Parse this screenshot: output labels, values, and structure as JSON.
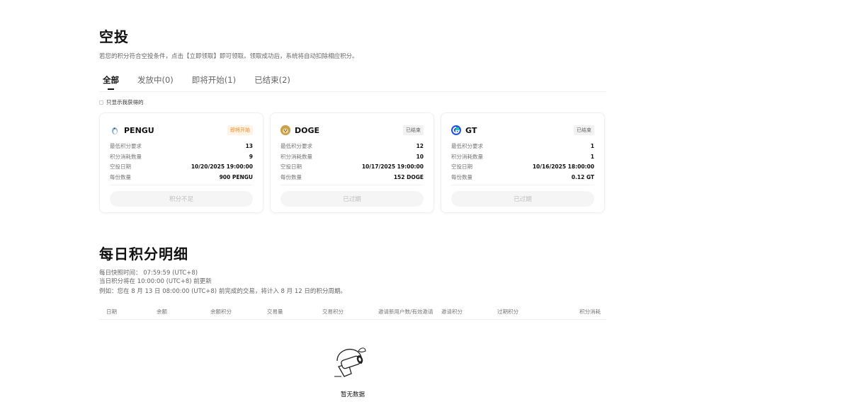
{
  "airdrop": {
    "title": "空投",
    "description": "若您的积分符合空投条件，点击【立即领取】即可领取。领取成功后，系统将自动扣除相应积分。",
    "tabs": [
      "全部",
      "发放中(0)",
      "即将开始(1)",
      "已结束(2)"
    ],
    "active_tab": "全部",
    "only_mine_label": "只显示我获得的",
    "cards": [
      {
        "coin": "PENGU",
        "icon": "penguin-icon",
        "status": "即将开始",
        "status_color": "#f08a24",
        "rows": [
          {
            "label": "最低积分要求",
            "value": "13"
          },
          {
            "label": "积分消耗数量",
            "value": "9"
          },
          {
            "label": "空投日期",
            "value": "10/20/2025 19:00:00"
          },
          {
            "label": "每份数量",
            "value": "900 PENGU"
          }
        ],
        "button": "积分不足"
      },
      {
        "coin": "DOGE",
        "icon": "doge-icon",
        "status": "已结束",
        "status_color": "#666666",
        "rows": [
          {
            "label": "最低积分要求",
            "value": "12"
          },
          {
            "label": "积分消耗数量",
            "value": "10"
          },
          {
            "label": "空投日期",
            "value": "10/17/2025 19:00:00"
          },
          {
            "label": "每份数量",
            "value": "152 DOGE"
          }
        ],
        "button": "已过期"
      },
      {
        "coin": "GT",
        "icon": "gt-icon",
        "status": "已结束",
        "status_color": "#666666",
        "rows": [
          {
            "label": "最低积分要求",
            "value": "1"
          },
          {
            "label": "积分消耗数量",
            "value": "1"
          },
          {
            "label": "空投日期",
            "value": "10/16/2025 18:00:00"
          },
          {
            "label": "每份数量",
            "value": "0.12 GT"
          }
        ],
        "button": "已过期"
      }
    ]
  },
  "daily": {
    "title": "每日积分明细",
    "snapshot": "每日快照时间： 07:59:59 (UTC+8)",
    "update": "当日积分将在 10:00:00 (UTC+8) 前更新",
    "example": "例如：您在 8 月 13 日 08:00:00 (UTC+8) 前完成的交易，将计入 8 月 12 日的积分周期。",
    "columns": [
      "日期",
      "余额",
      "余额积分",
      "交易量",
      "交易积分",
      "邀请新用户数/有效邀请",
      "邀请积分",
      "过期积分",
      "积分消耗"
    ],
    "empty_text": "暂无数据"
  },
  "colors": {
    "accent_orange": "#f08a24",
    "doge_gold": "#c8a24a",
    "gt_blue": "#2354e6"
  }
}
